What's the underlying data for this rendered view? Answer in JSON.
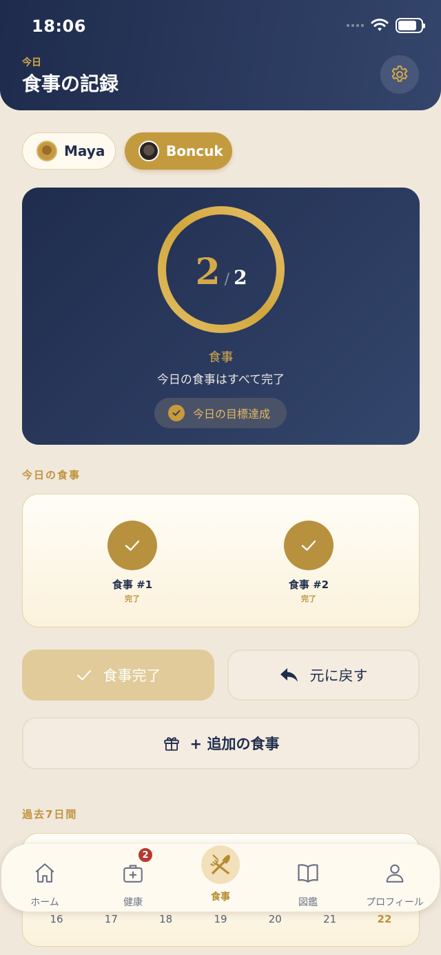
{
  "status_bar": {
    "time": "18:06"
  },
  "header": {
    "subtitle": "今日",
    "title": "食事の記録"
  },
  "pets": [
    {
      "name": "Maya",
      "selected": false
    },
    {
      "name": "Boncuk",
      "selected": true
    }
  ],
  "summary": {
    "count": "2",
    "slash": "/",
    "total": "2",
    "progress": 1.0,
    "label": "食事",
    "description": "今日の食事はすべて完了",
    "goal_text": "今日の目標達成"
  },
  "today_meals": {
    "section_title": "今日の食事",
    "items": [
      {
        "name": "食事 #1",
        "status": "完了"
      },
      {
        "name": "食事 #2",
        "status": "完了"
      }
    ]
  },
  "actions": {
    "done_label": "食事完了",
    "undo_label": "元に戻す",
    "extra_label": "+ 追加の食事"
  },
  "history": {
    "section_title": "過去7日間",
    "days": [
      "16",
      "17",
      "18",
      "19",
      "20",
      "21",
      "22"
    ],
    "today": "22"
  },
  "tabbar": {
    "items": [
      {
        "label": "ホーム",
        "icon": "home-icon"
      },
      {
        "label": "健康",
        "icon": "medkit-icon",
        "badge": "2"
      },
      {
        "label": "食事",
        "icon": "fork-knife-icon",
        "active": true
      },
      {
        "label": "図鑑",
        "icon": "book-icon"
      },
      {
        "label": "プロフィール",
        "icon": "person-icon"
      }
    ]
  },
  "colors": {
    "navy": "#1f2c4d",
    "gold": "#c39a3e",
    "background": "#f1e8dc",
    "badge_red": "#b8382f"
  }
}
